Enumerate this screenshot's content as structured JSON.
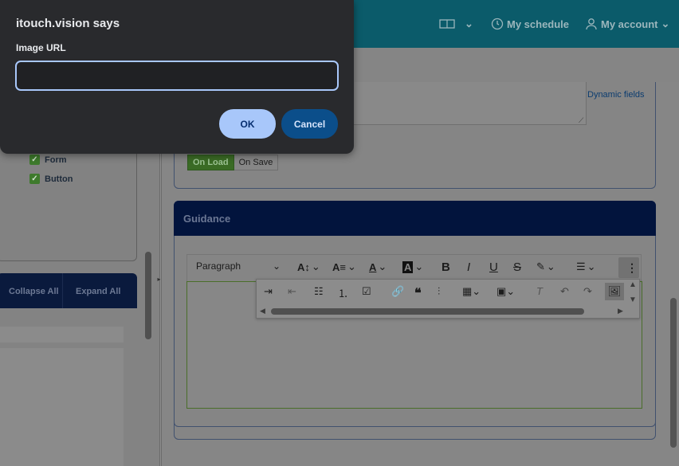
{
  "dialog": {
    "title": "itouch.vision says",
    "label": "Image URL",
    "input_value": "",
    "ok_label": "OK",
    "cancel_label": "Cancel"
  },
  "header": {
    "schedule_label": "My schedule",
    "account_label": "My account"
  },
  "left_panel": {
    "checkboxes": [
      {
        "label": "Form",
        "checked": true
      },
      {
        "label": "Button",
        "checked": true
      }
    ],
    "collapse_all": "Collapse All",
    "expand_all": "Expand All"
  },
  "main": {
    "dynamic_fields_link": "Dynamic fields",
    "trigger_toggle": [
      "On Load",
      "On Save"
    ],
    "trigger_selected": "On Load",
    "guidance_title": "Guidance",
    "editor": {
      "block_format": "Paragraph",
      "toolbar_icons": [
        "font-size-icon",
        "font-family-icon",
        "font-color-icon",
        "background-color-icon",
        "bold-icon",
        "italic-icon",
        "underline-icon",
        "strikethrough-icon",
        "highlight-icon",
        "align-icon",
        "more-icon"
      ],
      "overflow_icons": [
        "indent-icon",
        "outdent-icon",
        "bulleted-list-icon",
        "numbered-list-icon",
        "todo-list-icon",
        "link-icon",
        "blockquote-icon",
        "page-break-icon",
        "table-icon",
        "media-icon",
        "remove-format-icon",
        "undo-icon",
        "redo-icon",
        "image-icon"
      ]
    }
  },
  "colors": {
    "overlay": "#8f8f8f",
    "header": "#0b5b6a",
    "navy": "#02143d",
    "dialog_bg": "#292a2d",
    "ok_bg": "#a8c7fa",
    "cancel_bg": "#0b4e8a",
    "checkbox_green": "#3e7a2c"
  }
}
